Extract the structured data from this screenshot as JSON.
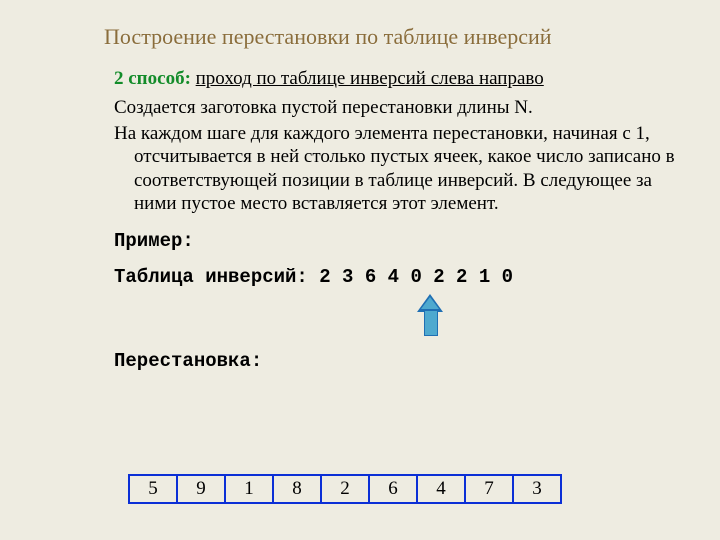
{
  "title": "Построение перестановки по таблице инверсий",
  "method": {
    "label": "2 способ:",
    "text": "проход по таблице инверсий слева направо"
  },
  "paragraphs": {
    "p1": "Создается заготовка пустой перестановки длины N.",
    "p2": "На каждом шаге для каждого элемента перестановки, начиная с 1, отсчитывается в ней столько пустых ячеек, какое число записано в соответствующей позиции в таблице инверсий.  В следующее за ними пустое место вставляется этот элемент."
  },
  "example_label": "Пример:",
  "inversion_line": "Таблица инверсий: 2 3 6 4 0 2 2 1 0",
  "perm_label": "Перестановка:",
  "cells": [
    "5",
    "9",
    "1",
    "8",
    "2",
    "6",
    "4",
    "7",
    "3"
  ],
  "chart_data": {
    "type": "table",
    "inversion_table": [
      2,
      3,
      6,
      4,
      0,
      2,
      2,
      1,
      0
    ],
    "permutation": [
      5,
      9,
      1,
      8,
      2,
      6,
      4,
      7,
      3
    ]
  }
}
